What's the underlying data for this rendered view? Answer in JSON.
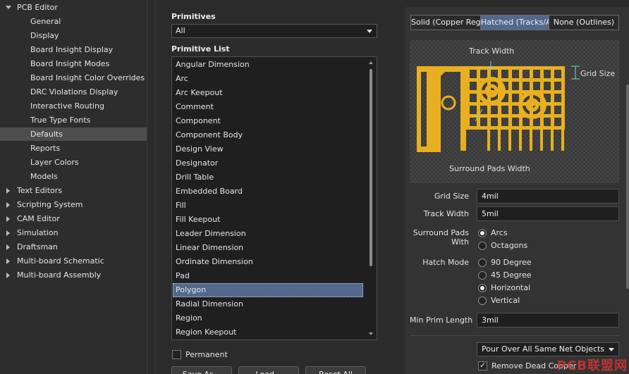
{
  "tree": {
    "items": [
      {
        "label": "PCB Editor",
        "level": "top",
        "expanded": true
      },
      {
        "label": "General",
        "level": "child"
      },
      {
        "label": "Display",
        "level": "child"
      },
      {
        "label": "Board Insight Display",
        "level": "child"
      },
      {
        "label": "Board Insight Modes",
        "level": "child"
      },
      {
        "label": "Board Insight Color Overrides",
        "level": "child"
      },
      {
        "label": "DRC Violations Display",
        "level": "child"
      },
      {
        "label": "Interactive Routing",
        "level": "child"
      },
      {
        "label": "True Type Fonts",
        "level": "child"
      },
      {
        "label": "Defaults",
        "level": "child",
        "selected": true
      },
      {
        "label": "Reports",
        "level": "child"
      },
      {
        "label": "Layer Colors",
        "level": "child"
      },
      {
        "label": "Models",
        "level": "child"
      },
      {
        "label": "Text Editors",
        "level": "top"
      },
      {
        "label": "Scripting System",
        "level": "top"
      },
      {
        "label": "CAM Editor",
        "level": "top"
      },
      {
        "label": "Simulation",
        "level": "top"
      },
      {
        "label": "Draftsman",
        "level": "top"
      },
      {
        "label": "Multi-board Schematic",
        "level": "top"
      },
      {
        "label": "Multi-board Assembly",
        "level": "top"
      }
    ]
  },
  "primitives": {
    "label": "Primitives",
    "selected": "All"
  },
  "primitive_list": {
    "label": "Primitive List",
    "items": [
      "Angular Dimension",
      "Arc",
      "Arc Keepout",
      "Comment",
      "Component",
      "Component Body",
      "Design View",
      "Designator",
      "Drill Table",
      "Embedded Board",
      "Fill",
      "Fill Keepout",
      "Leader Dimension",
      "Linear Dimension",
      "Ordinate Dimension",
      "Pad",
      "Polygon",
      "Radial Dimension",
      "Region",
      "Region Keepout"
    ],
    "selected_index": 16
  },
  "permanent": {
    "label": "Permanent",
    "checked": false
  },
  "buttons": {
    "save_as": "Save As...",
    "load": "Load...",
    "reset_all": "Reset All"
  },
  "fill_mode_tabs": [
    {
      "label": "Solid (Copper Regions)",
      "active": false
    },
    {
      "label": "Hatched (Tracks/Arcs)",
      "active": true
    },
    {
      "label": "None (Outlines)",
      "active": false
    }
  ],
  "preview": {
    "track_width_label": "Track Width",
    "grid_size_label": "Grid Size",
    "surround_pads_label": "Surround Pads Width",
    "copper_color": "#e8b020"
  },
  "form": {
    "grid_size": {
      "label": "Grid Size",
      "value": "4mil"
    },
    "track_width": {
      "label": "Track Width",
      "value": "5mil"
    },
    "surround_pads": {
      "label": "Surround Pads With",
      "options": [
        "Arcs",
        "Octagons"
      ],
      "selected": "Arcs"
    },
    "hatch_mode": {
      "label": "Hatch Mode",
      "options": [
        "90 Degree",
        "45 Degree",
        "Horizontal",
        "Vertical"
      ],
      "selected": "Horizontal"
    },
    "min_prim_length": {
      "label": "Min Prim Length",
      "value": "3mil"
    },
    "pour_over": {
      "selected": "Pour Over All Same Net Objects"
    },
    "remove_dead_copper": {
      "label": "Remove Dead Copper",
      "checked": true
    }
  },
  "watermark": "PCB联盟网"
}
